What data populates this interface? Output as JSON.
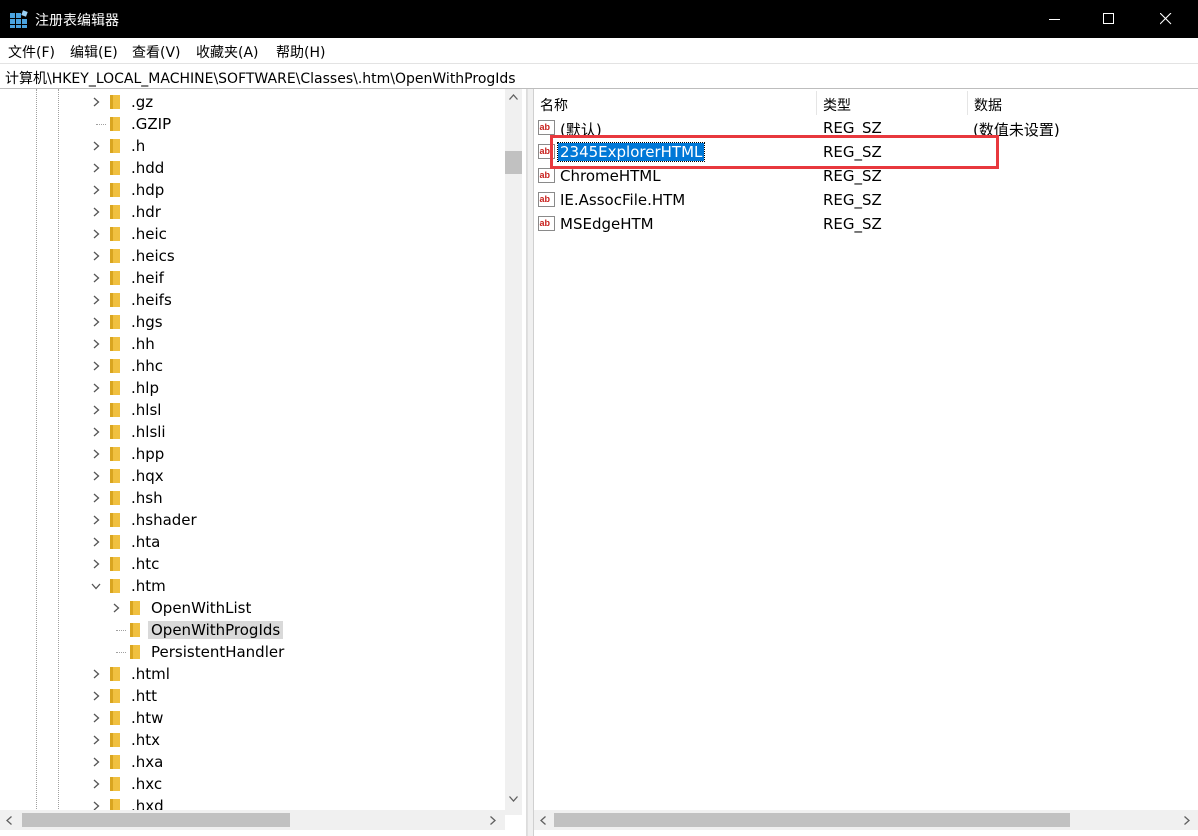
{
  "window": {
    "title": "注册表编辑器",
    "icon": "regedit-icon",
    "colors": {
      "titlebar": "#000000",
      "selection": "#0078d7",
      "highlight_box": "#e8383d",
      "folder": "#f0c040"
    }
  },
  "menu": [
    "文件(F)",
    "编辑(E)",
    "查看(V)",
    "收藏夹(A)",
    "帮助(H)"
  ],
  "address": "计算机\\HKEY_LOCAL_MACHINE\\SOFTWARE\\Classes\\.htm\\OpenWithProgIds",
  "tree": {
    "items": [
      {
        "label": ".gz",
        "expander": "collapsed"
      },
      {
        "label": ".GZIP",
        "expander": "none"
      },
      {
        "label": ".h",
        "expander": "collapsed"
      },
      {
        "label": ".hdd",
        "expander": "collapsed"
      },
      {
        "label": ".hdp",
        "expander": "collapsed"
      },
      {
        "label": ".hdr",
        "expander": "collapsed"
      },
      {
        "label": ".heic",
        "expander": "collapsed"
      },
      {
        "label": ".heics",
        "expander": "collapsed"
      },
      {
        "label": ".heif",
        "expander": "collapsed"
      },
      {
        "label": ".heifs",
        "expander": "collapsed"
      },
      {
        "label": ".hgs",
        "expander": "collapsed"
      },
      {
        "label": ".hh",
        "expander": "collapsed"
      },
      {
        "label": ".hhc",
        "expander": "collapsed"
      },
      {
        "label": ".hlp",
        "expander": "collapsed"
      },
      {
        "label": ".hlsl",
        "expander": "collapsed"
      },
      {
        "label": ".hlsli",
        "expander": "collapsed"
      },
      {
        "label": ".hpp",
        "expander": "collapsed"
      },
      {
        "label": ".hqx",
        "expander": "collapsed"
      },
      {
        "label": ".hsh",
        "expander": "collapsed"
      },
      {
        "label": ".hshader",
        "expander": "collapsed"
      },
      {
        "label": ".hta",
        "expander": "collapsed"
      },
      {
        "label": ".htc",
        "expander": "collapsed"
      },
      {
        "label": ".htm",
        "expander": "expanded"
      },
      {
        "label": "OpenWithList",
        "expander": "collapsed",
        "child": true
      },
      {
        "label": "OpenWithProgIds",
        "expander": "none",
        "child": true,
        "selected": true
      },
      {
        "label": "PersistentHandler",
        "expander": "none",
        "child": true
      },
      {
        "label": ".html",
        "expander": "collapsed"
      },
      {
        "label": ".htt",
        "expander": "collapsed"
      },
      {
        "label": ".htw",
        "expander": "collapsed"
      },
      {
        "label": ".htx",
        "expander": "collapsed"
      },
      {
        "label": ".hxa",
        "expander": "collapsed"
      },
      {
        "label": ".hxc",
        "expander": "collapsed"
      },
      {
        "label": ".hxd",
        "expander": "collapsed"
      }
    ]
  },
  "list": {
    "columns": {
      "name": "名称",
      "type": "类型",
      "data": "数据"
    },
    "rows": [
      {
        "name": "(默认)",
        "type": "REG_SZ",
        "data": "(数值未设置)"
      },
      {
        "name": "2345ExplorerHTML",
        "type": "REG_SZ",
        "data": "",
        "selected": true,
        "highlighted": true
      },
      {
        "name": "ChromeHTML",
        "type": "REG_SZ",
        "data": ""
      },
      {
        "name": "IE.AssocFile.HTM",
        "type": "REG_SZ",
        "data": ""
      },
      {
        "name": "MSEdgeHTM",
        "type": "REG_SZ",
        "data": ""
      }
    ]
  }
}
